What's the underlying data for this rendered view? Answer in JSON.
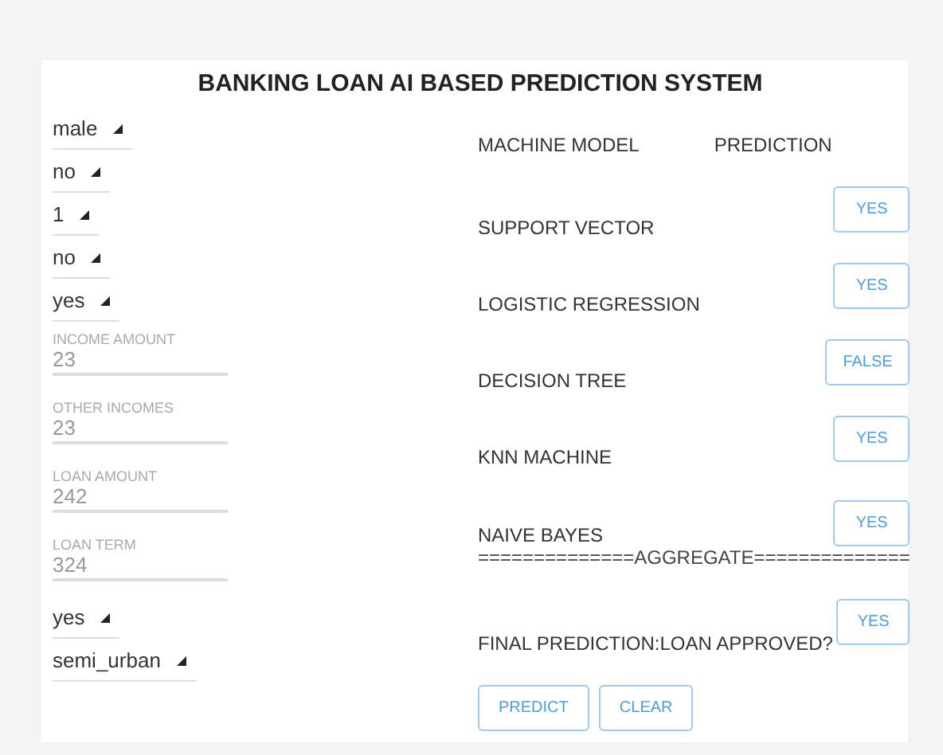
{
  "title": "BANKING LOAN AI BASED PREDICTION SYSTEM",
  "inputs": [
    {
      "kind": "select",
      "value": "male"
    },
    {
      "kind": "select",
      "value": "no"
    },
    {
      "kind": "select",
      "value": "1"
    },
    {
      "kind": "select",
      "value": "no"
    },
    {
      "kind": "select",
      "value": "yes"
    },
    {
      "kind": "text",
      "label": "INCOME AMOUNT",
      "value": "23"
    },
    {
      "kind": "text",
      "label": "OTHER INCOMES",
      "value": "23"
    },
    {
      "kind": "text",
      "label": "LOAN AMOUNT",
      "value": "242"
    },
    {
      "kind": "text",
      "label": "LOAN TERM",
      "value": "324"
    },
    {
      "kind": "select",
      "value": "yes"
    },
    {
      "kind": "select",
      "value": "semi_urban"
    }
  ],
  "header": {
    "model": "MACHINE MODEL",
    "prediction": "PREDICTION"
  },
  "models": [
    {
      "name": "SUPPORT VECTOR",
      "result": "YES"
    },
    {
      "name": "LOGISTIC REGRESSION",
      "result": "YES"
    },
    {
      "name": "DECISION TREE",
      "result": "FALSE"
    },
    {
      "name": "KNN MACHINE",
      "result": "YES"
    },
    {
      "name": "NAIVE BAYES",
      "result": "YES"
    }
  ],
  "aggregate": "==============AGGREGATE==============",
  "final": {
    "label": "FINAL PREDICTION:LOAN APPROVED?",
    "result": "YES"
  },
  "buttons": [
    "PREDICT",
    "CLEAR"
  ]
}
